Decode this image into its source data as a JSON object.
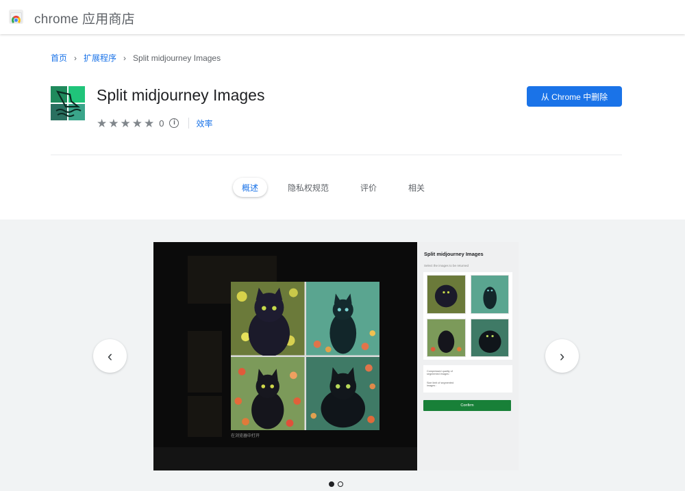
{
  "header": {
    "store_title": "chrome 应用商店",
    "logo_icon": "chrome-web-store-icon"
  },
  "breadcrumb": {
    "home": "首页",
    "section": "扩展程序",
    "current": "Split midjourney Images"
  },
  "extension": {
    "name": "Split midjourney Images",
    "rating_stars": 5,
    "rating_count": "0",
    "category": "效率",
    "remove_button": "从 Chrome 中删除",
    "icon_colors": [
      "#1f8a5c",
      "#20c47a",
      "#2a7060",
      "#3aa58a"
    ]
  },
  "tabs": [
    {
      "label": "概述",
      "active": true
    },
    {
      "label": "隐私权规范",
      "active": false
    },
    {
      "label": "评价",
      "active": false
    },
    {
      "label": "相关",
      "active": false
    }
  ],
  "screenshot": {
    "caption": "在浏览器中打开",
    "panel_title": "Split midjourney Images",
    "panel_subtitle": "Select the images to be returned",
    "option1": "Compressed quality of segmented images :",
    "option2": "Size limit of segmented images :",
    "confirm": "Confirm"
  },
  "carousel": {
    "prev_icon": "chevron-left-icon",
    "next_icon": "chevron-right-icon",
    "dots": 2,
    "active_dot": 0
  }
}
